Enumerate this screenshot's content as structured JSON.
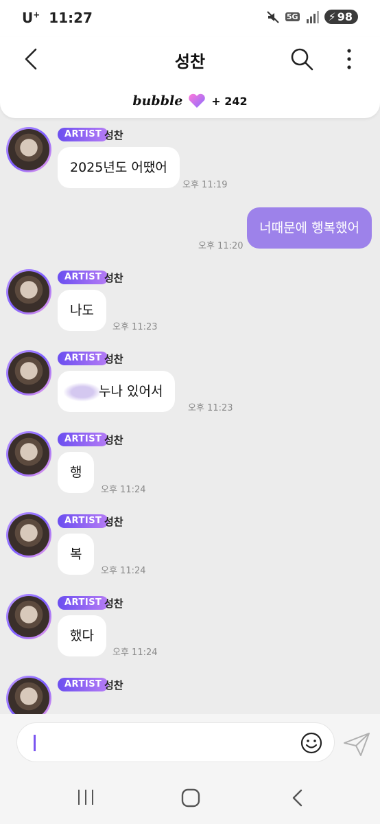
{
  "status_bar": {
    "carrier": "U",
    "carrier_sup": "+",
    "time": "11:27",
    "network": "5G",
    "battery": "98"
  },
  "header": {
    "title": "성찬",
    "brand": "bubble",
    "count": "+ 242"
  },
  "messages": [
    {
      "type": "in",
      "badge": "ARTIST",
      "sender": "성찬",
      "text": "2025년도 어땠어",
      "time": "오후 11:19"
    },
    {
      "type": "out",
      "text": "너때문에 행복했어",
      "time": "오후 11:20"
    },
    {
      "type": "in",
      "badge": "ARTIST",
      "sender": "성찬",
      "text": "나도",
      "time": "오후 11:23"
    },
    {
      "type": "in",
      "badge": "ARTIST",
      "sender": "성찬",
      "text": "누나 있어서",
      "time": "오후 11:23"
    },
    {
      "type": "in",
      "badge": "ARTIST",
      "sender": "성찬",
      "text": "행",
      "time": "오후 11:24"
    },
    {
      "type": "in",
      "badge": "ARTIST",
      "sender": "성찬",
      "text": "복",
      "time": "오후 11:24"
    },
    {
      "type": "in",
      "badge": "ARTIST",
      "sender": "성찬",
      "text": "했다",
      "time": "오후 11:24"
    },
    {
      "type": "in",
      "badge": "ARTIST",
      "sender": "성찬",
      "text": "",
      "time": ""
    }
  ],
  "composer": {
    "value": ""
  },
  "colors": {
    "accent": "#9d82ea",
    "badge_start": "#6b4ef0",
    "badge_end": "#b57cf5",
    "background": "#ececec"
  },
  "icons": [
    "back-icon",
    "search-icon",
    "more-icon",
    "heart-icon",
    "smiley-icon",
    "send-icon",
    "recent-apps-icon",
    "home-icon",
    "nav-back-icon"
  ]
}
